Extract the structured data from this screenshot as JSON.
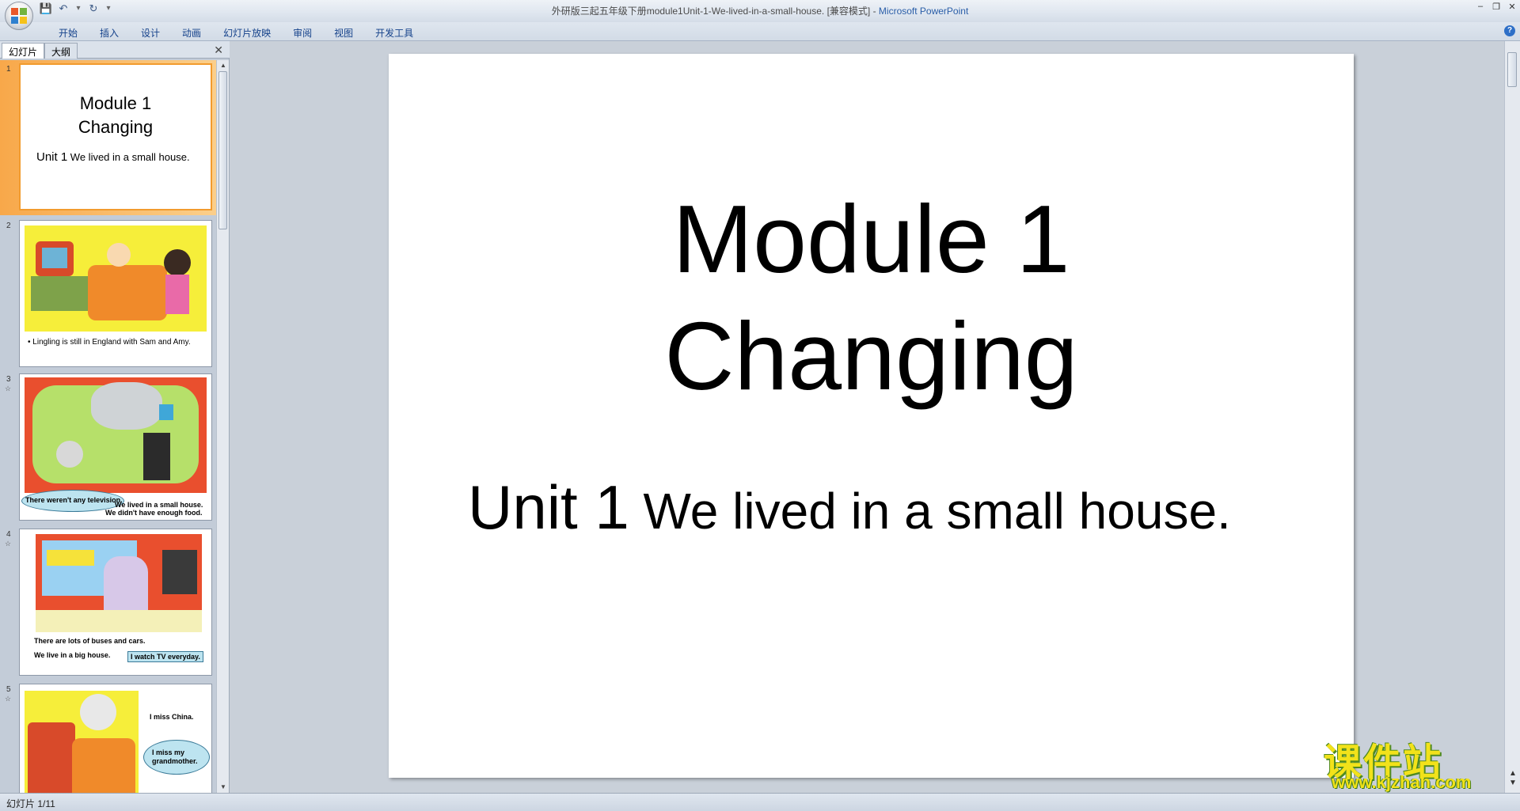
{
  "window": {
    "title_doc": "外研版三起五年级下册module1Unit-1-We-lived-in-a-small-house. [兼容模式] - ",
    "title_app": "Microsoft PowerPoint"
  },
  "ribbon": {
    "tabs": [
      "开始",
      "插入",
      "设计",
      "动画",
      "幻灯片放映",
      "审阅",
      "视图",
      "开发工具"
    ]
  },
  "panel": {
    "tab_slides": "幻灯片",
    "tab_outline": "大纲"
  },
  "thumbnails": [
    {
      "num": "1",
      "title_line1": "Module 1",
      "title_line2": "Changing",
      "sub_unit": "Unit 1",
      "sub_rest": " We lived in a small house."
    },
    {
      "num": "2",
      "caption": "•  Lingling is still in England with Sam and Amy."
    },
    {
      "num": "3",
      "caption_a": "There weren't any television.",
      "caption_b": "We lived in a small house.",
      "caption_c": "We didn't have enough food."
    },
    {
      "num": "4",
      "caption_a": "There are lots of buses and cars.",
      "caption_b": "We live in a big house.",
      "caption_c": "I watch TV everyday."
    },
    {
      "num": "5",
      "caption_a": "I miss China.",
      "caption_b": "I miss my grandmother."
    }
  ],
  "slide": {
    "title_line1": "Module 1",
    "title_line2": "Changing",
    "sub_unit": "Unit 1",
    "sub_rest": " We lived in a small house."
  },
  "status": {
    "text": "幻灯片 1/11"
  },
  "watermark": {
    "cn": "课件站",
    "url": "www.kjzhan.com"
  }
}
